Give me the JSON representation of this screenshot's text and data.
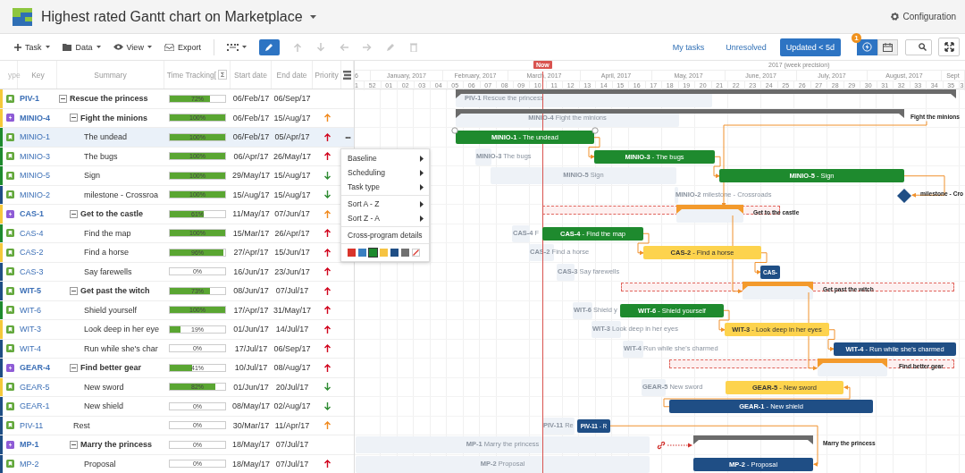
{
  "app": {
    "title": "Highest rated Gantt chart on Marketplace",
    "configuration": "Configuration"
  },
  "toolbar": {
    "menus": [
      {
        "label": "Task",
        "kind": "plus"
      },
      {
        "label": "Data",
        "kind": "folder"
      },
      {
        "label": "View",
        "kind": "eye"
      }
    ],
    "export": "Export",
    "edit_mode": {
      "on": true
    },
    "actions": [
      {
        "kind": "up",
        "disabled": true
      },
      {
        "kind": "down",
        "disabled": true
      },
      {
        "kind": "left",
        "disabled": true
      },
      {
        "kind": "right",
        "disabled": true
      },
      {
        "kind": "pencil",
        "disabled": true
      },
      {
        "kind": "trash",
        "disabled": true
      }
    ],
    "filters": [
      {
        "label": "My tasks",
        "selected": false
      },
      {
        "label": "Unresolved",
        "selected": false
      },
      {
        "label": "Updated < 5d",
        "selected": true
      }
    ],
    "views": [
      {
        "kind": "critical",
        "selected": true,
        "badge": "1"
      },
      {
        "kind": "calendar",
        "selected": false
      }
    ]
  },
  "columns": [
    "ype",
    "Key",
    "Summary",
    "Time Tracking[",
    "Start date",
    "End date",
    "Priority"
  ],
  "sigma": "Σ",
  "row_actions": "•••",
  "timeline": {
    "precision": "2017 (week precision)",
    "now": "Now",
    "months": [
      "6",
      "January, 2017",
      "February, 2017",
      "March, 2017",
      "April, 2017",
      "May, 2017",
      "June, 2017",
      "July, 2017",
      "August, 2017",
      "Sept"
    ],
    "weeks": [
      "1",
      "52",
      "01",
      "02",
      "03",
      "04",
      "05",
      "06",
      "07",
      "08",
      "09",
      "10",
      "11",
      "12",
      "13",
      "14",
      "15",
      "16",
      "17",
      "18",
      "19",
      "20",
      "21",
      "22",
      "23",
      "24",
      "25",
      "26",
      "27",
      "28",
      "29",
      "30",
      "31",
      "32",
      "33",
      "34",
      "35",
      "3"
    ]
  },
  "tasks": [
    {
      "key": "PIV-1",
      "kind": "story",
      "color": "#f5c93b",
      "summary": "Rescue the princess",
      "level": 0.72,
      "tracking": "72%",
      "start": "06/Feb/17",
      "end": "06/Sep/17",
      "selected": false,
      "expanded": true,
      "ghost": "**PIV-1** Rescue the princess",
      "bar": {
        "kind": "summary",
        "color": "#6b6b6b",
        "overdue": false,
        "linked": false
      },
      "children": [
        {
          "key": "MINIO-4",
          "kind": "epic",
          "color": "#f5c93b",
          "summary": "Fight the minions",
          "level": 1,
          "tracking": "100%",
          "start": "06/Feb/17",
          "end": "15/Aug/17",
          "priority": {
            "kind": "high"
          },
          "selected": false,
          "expanded": true,
          "ghost": "**MINIO-4** Fight the minions",
          "bar": {
            "kind": "summary",
            "color": "#6b6b6b",
            "overdue": false,
            "linked": false
          },
          "side_label": "Fight the minions",
          "children": [
            {
              "key": "MINIO-1",
              "kind": "story",
              "color": "#1e8a2e",
              "summary": "The undead",
              "level": 1,
              "tracking": "100%",
              "start": "06/Feb/17",
              "end": "05/Apr/17",
              "priority": {
                "kind": "highest"
              },
              "selected": true,
              "bar": {
                "kind": "task",
                "color": "#1e8a2e",
                "label": "**MINIO-1** - The undead"
              }
            },
            {
              "key": "MINIO-3",
              "kind": "story",
              "color": "#1e8a2e",
              "summary": "The bugs",
              "level": 1,
              "tracking": "100%",
              "start": "06/Apr/17",
              "end": "26/May/17",
              "priority": {
                "kind": "highest"
              },
              "selected": false,
              "ghost": "**MINIO-3** The bugs",
              "bar": {
                "kind": "task",
                "color": "#1e8a2e",
                "label": "**MINIO-3** - The bugs"
              }
            },
            {
              "key": "MINIO-5",
              "kind": "story",
              "color": "#1e8a2e",
              "summary": "Sign",
              "level": 1,
              "tracking": "100%",
              "start": "29/May/17",
              "end": "15/Aug/17",
              "priority": {
                "kind": "low"
              },
              "selected": false,
              "ghost": "**MINIO-5** Sign",
              "bar": {
                "kind": "task",
                "color": "#1e8a2e",
                "label": "**MINIO-5** - Sign"
              }
            },
            {
              "key": "MINIO-2",
              "kind": "story",
              "color": "#1f4e85",
              "summary": "milestone - Crossroa",
              "level": 1,
              "tracking": "100%",
              "start": "15/Aug/17",
              "end": "15/Aug/17",
              "priority": {
                "kind": "low"
              },
              "selected": false,
              "ghost": "**MINIO-2** milestone - Crossroads",
              "bar": {
                "kind": "milestone",
                "color": "#1f4e85"
              },
              "side_label": "milestone - Cro"
            }
          ]
        },
        {
          "key": "CAS-1",
          "kind": "epic",
          "color": "#f5c93b",
          "summary": "Get to the castle",
          "level": 0.61,
          "tracking": "61%",
          "start": "11/May/17",
          "end": "07/Jun/17",
          "priority": {
            "kind": "high"
          },
          "selected": false,
          "expanded": true,
          "bar": {
            "kind": "summary",
            "color": "#f39a2c",
            "overdue": true,
            "linked": false
          },
          "side_label": "Get to the castle",
          "children": [
            {
              "key": "CAS-4",
              "kind": "story",
              "color": "#1e8a2e",
              "summary": "Find the map",
              "level": 1,
              "tracking": "100%",
              "start": "15/Mar/17",
              "end": "26/Apr/17",
              "priority": {
                "kind": "highest"
              },
              "selected": false,
              "ghost": "**CAS-4** F",
              "bar": {
                "kind": "task",
                "color": "#1e8a2e",
                "label": "**CAS-4** - Find the map"
              }
            },
            {
              "key": "CAS-2",
              "kind": "story",
              "color": "#f5c93b",
              "summary": "Find a horse",
              "level": 0.96,
              "tracking": "96%",
              "start": "27/Apr/17",
              "end": "15/Jun/17",
              "priority": {
                "kind": "highest"
              },
              "selected": false,
              "ghost": "**CAS-2** Find a horse",
              "bar": {
                "kind": "task",
                "color": "#fdd34d",
                "label": "**CAS-2** - Find a horse"
              }
            },
            {
              "key": "CAS-3",
              "kind": "story",
              "color": "#1f4e85",
              "summary": "Say farewells",
              "level": 0,
              "tracking": "0%",
              "start": "16/Jun/17",
              "end": "23/Jun/17",
              "priority": {
                "kind": "highest"
              },
              "selected": false,
              "ghost": "**CAS-3** Say farewells",
              "bar": {
                "kind": "task",
                "color": "#1f4e85",
                "label": "**CAS-**"
              }
            }
          ]
        },
        {
          "key": "WIT-5",
          "kind": "story",
          "color": "#1f4e85",
          "summary": "Get past the witch",
          "level": 0.73,
          "tracking": "73%",
          "start": "08/Jun/17",
          "end": "07/Jul/17",
          "priority": {
            "kind": "highest"
          },
          "selected": false,
          "expanded": true,
          "bar": {
            "kind": "summary",
            "color": "#f39a2c",
            "overdue": true,
            "linked": false
          },
          "side_label": "Get past the witch",
          "children": [
            {
              "key": "WIT-6",
              "kind": "story",
              "color": "#1e8a2e",
              "summary": "Shield yourself",
              "level": 1,
              "tracking": "100%",
              "start": "17/Apr/17",
              "end": "31/May/17",
              "priority": {
                "kind": "highest"
              },
              "selected": false,
              "ghost": "**WIT-6** Shield y",
              "bar": {
                "kind": "task",
                "color": "#1e8a2e",
                "label": "**WIT-6** - Shield yourself"
              }
            },
            {
              "key": "WIT-3",
              "kind": "story",
              "color": "#f5c93b",
              "summary": "Look deep in her eye",
              "level": 0.19,
              "tracking": "19%",
              "start": "01/Jun/17",
              "end": "14/Jul/17",
              "priority": {
                "kind": "highest"
              },
              "selected": false,
              "ghost": "**WIT-3** Look deep in her eyes",
              "bar": {
                "kind": "task",
                "color": "#fdd34d",
                "label": "**WIT-3** - Look deep in her eyes"
              }
            },
            {
              "key": "WIT-4",
              "kind": "story",
              "color": "#1f4e85",
              "summary": "Run while she's char",
              "level": 0,
              "tracking": "0%",
              "start": "17/Jul/17",
              "end": "06/Sep/17",
              "priority": {
                "kind": "highest"
              },
              "selected": false,
              "ghost": "**WIT-4** Run while she's charmed",
              "bar": {
                "kind": "task",
                "color": "#1f4e85",
                "label": "**WIT-4** - Run while she's charmed"
              }
            }
          ]
        },
        {
          "key": "GEAR-4",
          "kind": "epic",
          "color": "#1f4e85",
          "summary": "Find better gear",
          "level": 0.41,
          "tracking": "41%",
          "start": "10/Jul/17",
          "end": "08/Aug/17",
          "priority": {
            "kind": "highest"
          },
          "selected": false,
          "expanded": true,
          "bar": {
            "kind": "summary",
            "color": "#f39a2c",
            "overdue": true,
            "linked": false
          },
          "side_label": "Find better gear",
          "children": [
            {
              "key": "GEAR-5",
              "kind": "story",
              "color": "#f5c93b",
              "summary": "New sword",
              "level": 0.82,
              "tracking": "82%",
              "start": "01/Jun/17",
              "end": "20/Jul/17",
              "priority": {
                "kind": "low"
              },
              "selected": false,
              "ghost": "**GEAR-5** New sword",
              "bar": {
                "kind": "task",
                "color": "#fdd34d",
                "label": "**GEAR-5** - New sword"
              }
            },
            {
              "key": "GEAR-1",
              "kind": "story",
              "color": "#1f4e85",
              "summary": "New shield",
              "level": 0,
              "tracking": "0%",
              "start": "08/May/17",
              "end": "02/Aug/17",
              "priority": {
                "kind": "low"
              },
              "selected": false,
              "bar": {
                "kind": "task",
                "color": "#1f4e85",
                "label": "**GEAR-1** - New shield"
              }
            }
          ]
        },
        {
          "key": "PIV-11",
          "kind": "story",
          "color": "#1f4e85",
          "summary": "Rest",
          "level": 0,
          "tracking": "0%",
          "start": "30/Mar/17",
          "end": "11/Apr/17",
          "priority": {
            "kind": "high"
          },
          "selected": false,
          "ghost": "**PIV-11** Re",
          "bar": {
            "kind": "task",
            "color": "#1f4e85",
            "label": "**PIV-11** - R"
          }
        },
        {
          "key": "MP-1",
          "kind": "epic",
          "color": "#1f4e85",
          "summary": "Marry the princess",
          "level": 0,
          "tracking": "0%",
          "start": "18/May/17",
          "end": "07/Jul/17",
          "selected": false,
          "expanded": true,
          "ghost": "**MP-1** Marry the princess",
          "bar": {
            "kind": "summary",
            "color": "#6b6b6b",
            "overdue": false,
            "linked": true
          },
          "side_label": "Marry the princess",
          "children": [
            {
              "key": "MP-2",
              "kind": "story",
              "color": "#1f4e85",
              "summary": "Proposal",
              "level": 0,
              "tracking": "0%",
              "start": "18/May/17",
              "end": "07/Jul/17",
              "priority": {
                "kind": "highest"
              },
              "selected": false,
              "ghost": "**MP-2** Proposal",
              "bar": {
                "kind": "task",
                "color": "#1f4e85",
                "label": "**MP-2** - Proposal"
              }
            }
          ]
        }
      ]
    }
  ],
  "context_menu": {
    "groups": [
      [
        {
          "label": "Baseline",
          "submenu": true
        },
        {
          "label": "Scheduling",
          "submenu": true
        },
        {
          "label": "Task type",
          "submenu": true
        }
      ],
      [
        {
          "label": "Sort A - Z",
          "submenu": true
        },
        {
          "label": "Sort Z - A",
          "submenu": true
        }
      ],
      [
        {
          "label": "Cross-program details",
          "submenu": false
        }
      ]
    ],
    "swatches": [
      {
        "kind": "color",
        "color": "#d9342b",
        "selected": false
      },
      {
        "kind": "color",
        "color": "#3a7fc1",
        "selected": false
      },
      {
        "kind": "color",
        "color": "#1e8a2e",
        "selected": true
      },
      {
        "kind": "color",
        "color": "#f6c342",
        "selected": false
      },
      {
        "kind": "color",
        "color": "#1f4e85",
        "selected": false
      },
      {
        "kind": "color",
        "color": "#707070",
        "selected": false
      },
      {
        "kind": "clear",
        "selected": false
      }
    ]
  }
}
